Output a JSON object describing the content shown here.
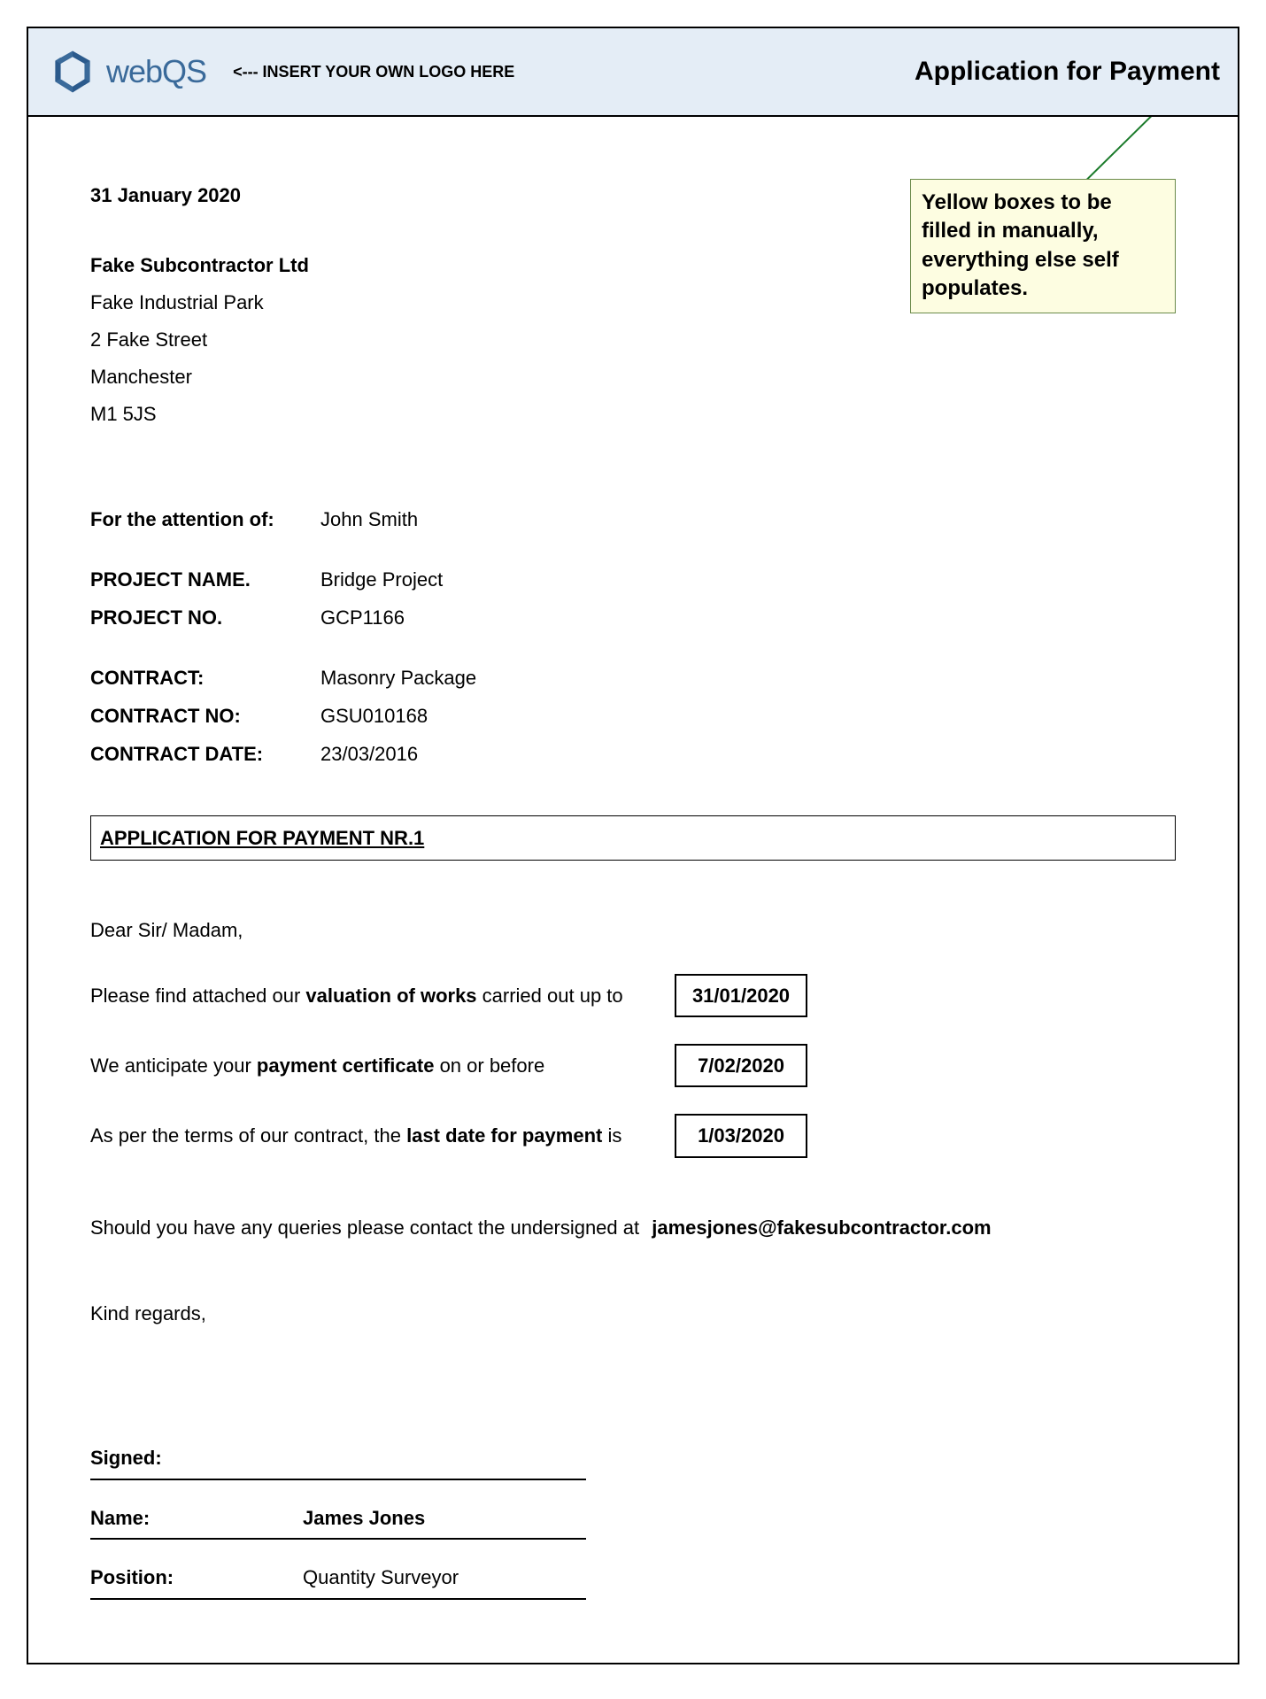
{
  "header": {
    "logo_text": "webQS",
    "logo_hint": "<--- INSERT YOUR OWN LOGO HERE",
    "title": "Application for Payment"
  },
  "note": "Yellow boxes to be filled in manually, everything else self populates.",
  "date": "31 January 2020",
  "address": {
    "company": "Fake Subcontractor Ltd",
    "line1": "Fake Industrial Park",
    "line2": "2 Fake Street",
    "city": "Manchester",
    "postcode": "M1 5JS"
  },
  "info": {
    "attention_label": "For the attention of:",
    "attention_value": "John Smith",
    "project_name_label": "PROJECT NAME.",
    "project_name_value": "Bridge Project",
    "project_no_label": "PROJECT NO.",
    "project_no_value": "GCP1166",
    "contract_label": "CONTRACT:",
    "contract_value": "Masonry Package",
    "contract_no_label": "CONTRACT NO:",
    "contract_no_value": "GSU010168",
    "contract_date_label": "CONTRACT DATE:",
    "contract_date_value": "23/03/2016"
  },
  "section_title": "APPLICATION FOR PAYMENT NR.1",
  "salutation": "Dear Sir/ Madam,",
  "lines": {
    "l1_pre": "Please find attached our ",
    "l1_bold": "valuation of works",
    "l1_post": " carried out up to",
    "l1_date": "31/01/2020",
    "l2_pre": "We anticipate your ",
    "l2_bold": "payment certificate",
    "l2_post": " on or before",
    "l2_date": "7/02/2020",
    "l3_pre": "As per the terms of our contract, the ",
    "l3_bold": "last date for payment",
    "l3_post": " is",
    "l3_date": "1/03/2020"
  },
  "contact_text": "Should you have any queries please contact the undersigned at",
  "contact_email": "jamesjones@fakesubcontractor.com",
  "regards": "Kind regards,",
  "sign": {
    "signed_label": "Signed:",
    "name_label": "Name:",
    "name_value": "James Jones",
    "position_label": "Position:",
    "position_value": "Quantity Surveyor"
  }
}
